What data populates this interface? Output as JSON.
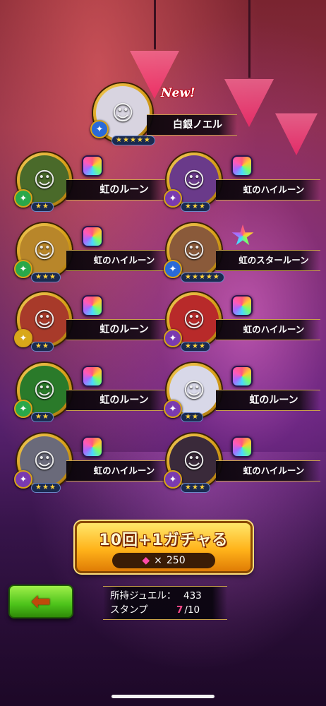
{
  "featured": {
    "name": "白銀ノエル",
    "new_label": "New!",
    "stars": 5,
    "max_stars": 5,
    "portrait_icon": "silver-haired-knight-portrait",
    "element_icon": "water-element-icon",
    "colors": {
      "portrait_bg": "#d8d4e0",
      "badge_bg": "#2a6ad8"
    }
  },
  "rewards": [
    {
      "label": "虹のルーン",
      "rune": "rainbow-rune-gem",
      "stars": 2,
      "portrait_icon": "wolf-beast-portrait",
      "element_icon": "wind-element-icon",
      "portrait_bg": "#4a6a2a",
      "badge_bg": "#2aa84a"
    },
    {
      "label": "虹のハイルーン",
      "rune": "rainbow-high-rune-gem",
      "stars": 3,
      "portrait_icon": "pharaoh-girl-portrait",
      "element_icon": "dark-element-icon",
      "portrait_bg": "#6a3a8a",
      "badge_bg": "#7a3ab0"
    },
    {
      "label": "虹のハイルーン",
      "rune": "rainbow-high-rune-gem",
      "stars": 3,
      "portrait_icon": "green-hair-hat-girl-portrait",
      "element_icon": "wind-element-icon",
      "portrait_bg": "#b8862a",
      "badge_bg": "#2aa84a"
    },
    {
      "label": "虹のスタールーン",
      "rune": "rainbow-star-rune",
      "stars": 5,
      "portrait_icon": "blond-glasses-man-portrait",
      "element_icon": "water-element-icon",
      "portrait_bg": "#8a5a3a",
      "badge_bg": "#2a6ad8"
    },
    {
      "label": "虹のルーン",
      "rune": "rainbow-rune-gem",
      "stars": 2,
      "portrait_icon": "owl-creature-portrait",
      "element_icon": "light-element-icon",
      "portrait_bg": "#a83a2a",
      "badge_bg": "#d8a81a"
    },
    {
      "label": "虹のハイルーン",
      "rune": "rainbow-high-rune-gem",
      "stars": 3,
      "portrait_icon": "red-pompadour-man-portrait",
      "element_icon": "dark-element-icon",
      "portrait_bg": "#b82a2a",
      "badge_bg": "#7a3ab0"
    },
    {
      "label": "虹のルーン",
      "rune": "rainbow-rune-gem",
      "stars": 2,
      "portrait_icon": "green-armor-warrior-portrait",
      "element_icon": "wind-element-icon",
      "portrait_bg": "#2a7a2a",
      "badge_bg": "#2aa84a"
    },
    {
      "label": "虹のルーン",
      "rune": "rainbow-rune-gem",
      "stars": 2,
      "portrait_icon": "white-cat-portrait",
      "element_icon": "dark-element-icon",
      "portrait_bg": "#d8d8e8",
      "badge_bg": "#7a3ab0"
    },
    {
      "label": "虹のハイルーン",
      "rune": "rainbow-high-rune-gem",
      "stars": 3,
      "portrait_icon": "conquistador-helmet-portrait",
      "element_icon": "dark-element-icon",
      "portrait_bg": "#6a6a7a",
      "badge_bg": "#7a3ab0"
    },
    {
      "label": "虹のハイルーン",
      "rune": "rainbow-high-rune-gem",
      "stars": 3,
      "portrait_icon": "green-hair-maid-portrait",
      "element_icon": "dark-element-icon",
      "portrait_bg": "#3a2a3a",
      "badge_bg": "#7a3ab0"
    }
  ],
  "gacha_button": {
    "title": "10回+1ガチャる",
    "cost_prefix": "×",
    "cost": "250",
    "gem_icon": "pink-diamond-icon",
    "colors": {
      "face": "#ffb31a",
      "border": "#8a4a00"
    }
  },
  "back_button": {
    "icon": "back-arrow-icon",
    "arrow_glyph": "⬅"
  },
  "info": {
    "jewel_label": "所持ジュエル：",
    "jewel_value": "433",
    "stamp_label": "スタンプ",
    "stamp_current": "7",
    "stamp_total": "/10"
  }
}
